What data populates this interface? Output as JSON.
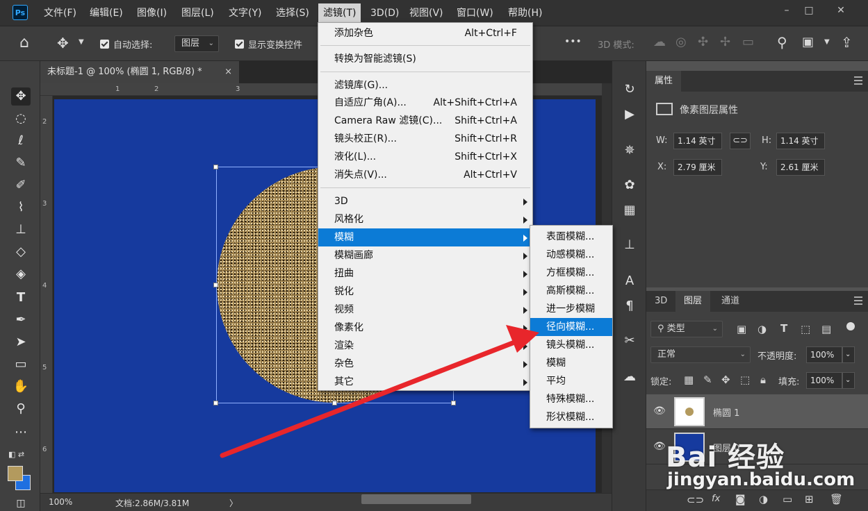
{
  "app": {
    "logo": "Ps"
  },
  "menubar": {
    "items": [
      "文件(F)",
      "编辑(E)",
      "图像(I)",
      "图层(L)",
      "文字(Y)",
      "选择(S)",
      "滤镜(T)",
      "3D(D)",
      "视图(V)",
      "窗口(W)",
      "帮助(H)"
    ],
    "active": "滤镜(T)",
    "window_buttons": [
      "–",
      "□",
      "✕"
    ]
  },
  "options_bar": {
    "auto_select_label": "自动选择:",
    "auto_select_value": "图层",
    "show_transform_label": "显示变换控件",
    "more": "•••",
    "mode_3d_label": "3D 模式:"
  },
  "document": {
    "tab_title": "未标题-1 @ 100% (椭圆 1, RGB/8) *",
    "tab_close": "×",
    "canvas_color": "#163a9e",
    "ruler_h": [
      "1",
      "2",
      "3"
    ],
    "ruler_v": [
      "2",
      "3",
      "4",
      "5",
      "6"
    ]
  },
  "status_bar": {
    "zoom": "100%",
    "doc_info": "文档:2.86M/3.81M",
    "arrow": "〉"
  },
  "filter_menu": {
    "items": [
      {
        "label": "添加杂色",
        "shortcut": "Alt+Ctrl+F"
      },
      {
        "label": "转换为智能滤镜(S)",
        "shortcut": ""
      },
      {
        "label": "滤镜库(G)...",
        "shortcut": ""
      },
      {
        "label": "自适应广角(A)...",
        "shortcut": "Alt+Shift+Ctrl+A"
      },
      {
        "label": "Camera Raw 滤镜(C)...",
        "shortcut": "Shift+Ctrl+A"
      },
      {
        "label": "镜头校正(R)...",
        "shortcut": "Shift+Ctrl+R"
      },
      {
        "label": "液化(L)...",
        "shortcut": "Shift+Ctrl+X"
      },
      {
        "label": "消失点(V)...",
        "shortcut": "Alt+Ctrl+V"
      },
      {
        "label": "3D",
        "shortcut": ""
      },
      {
        "label": "风格化",
        "shortcut": ""
      },
      {
        "label": "模糊",
        "shortcut": ""
      },
      {
        "label": "模糊画廊",
        "shortcut": ""
      },
      {
        "label": "扭曲",
        "shortcut": ""
      },
      {
        "label": "锐化",
        "shortcut": ""
      },
      {
        "label": "视频",
        "shortcut": ""
      },
      {
        "label": "像素化",
        "shortcut": ""
      },
      {
        "label": "渲染",
        "shortcut": ""
      },
      {
        "label": "杂色",
        "shortcut": ""
      },
      {
        "label": "其它",
        "shortcut": ""
      }
    ],
    "highlighted": "模糊"
  },
  "blur_submenu": {
    "items": [
      "表面模糊...",
      "动感模糊...",
      "方框模糊...",
      "高斯模糊...",
      "进一步模糊",
      "径向模糊...",
      "镜头模糊...",
      "模糊",
      "平均",
      "特殊模糊...",
      "形状模糊..."
    ],
    "highlighted": "径向模糊..."
  },
  "properties_panel": {
    "tab": "属性",
    "section_title": "像素图层属性",
    "w_label": "W:",
    "w_value": "1.14 英寸",
    "h_label": "H:",
    "h_value": "1.14 英寸",
    "x_label": "X:",
    "x_value": "2.79 厘米",
    "y_label": "Y:",
    "y_value": "2.61 厘米"
  },
  "layers_panel": {
    "tabs": [
      "3D",
      "图层",
      "通道"
    ],
    "active_tab": "图层",
    "filter_label": "类型",
    "blend_mode": "正常",
    "opacity_label": "不透明度:",
    "opacity_value": "100%",
    "lock_label": "锁定:",
    "fill_label": "填充:",
    "fill_value": "100%",
    "layers": [
      {
        "name": "椭圆 1",
        "selected": true
      },
      {
        "name": "图层 0",
        "selected": false
      }
    ],
    "footer_fx": "fx"
  },
  "watermark": {
    "line1": "Bai 经验",
    "line2": "jingyan.baidu.com"
  },
  "colors": {
    "accent": "#0c7bd6",
    "annotation_arrow": "#e8262b",
    "foreground_swatch": "#b39a5e",
    "background_swatch": "#1f6fe0"
  }
}
